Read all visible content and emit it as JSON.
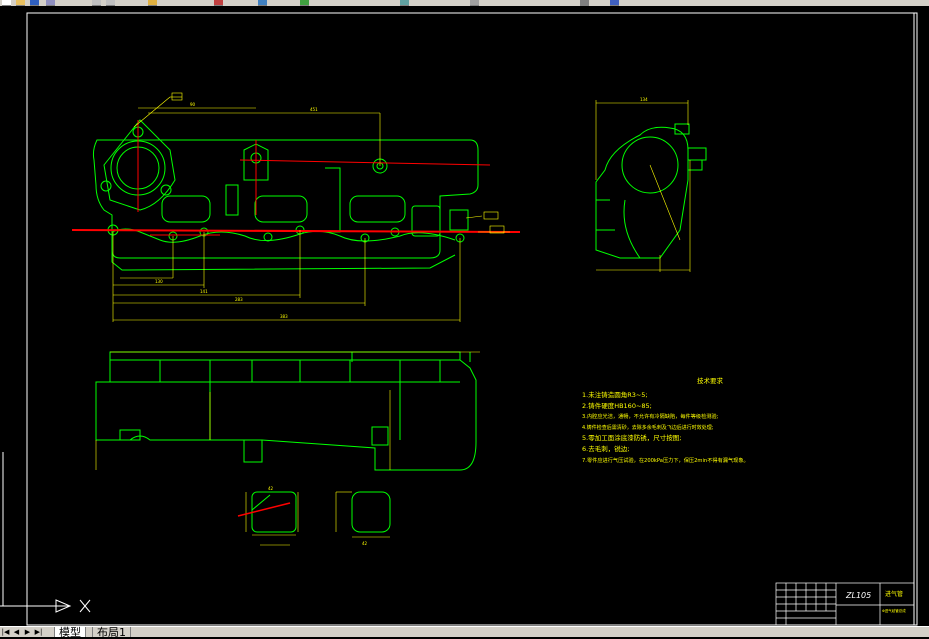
{
  "drawing": {
    "tech_title": "技术要求",
    "tech_notes": [
      "1.未注铸造圆角R3~5;",
      "2.铸件硬度HB160~85;",
      "3.内腔应光洁，通畅，不允许有冷隔缺陷，每件等级检测验;",
      "4.铸件检查后需清砂，去除多余毛刺及飞边后进行时效处理;",
      "5.零加工面涂底漆防锈，尺寸按图;",
      "6.去毛刺，锐边;",
      "7.零件应进行气压试验，在200kPa压力下，保压2min不得有漏气现象。"
    ],
    "title_block": {
      "part_code": "ZL105",
      "part_name": "进气管",
      "subtitle": "Φ进气歧管总成"
    },
    "dims": {
      "d1": "90",
      "d2": "451",
      "d3": "130",
      "d4": "141",
      "d5": "283",
      "d6": "383",
      "d7": "134",
      "d8": "42",
      "d9": "42"
    }
  },
  "ucs": {
    "x_label": "X"
  },
  "tabs": {
    "model": "模型",
    "layout1": "布局1"
  },
  "colors": {
    "outline": "#00ff00",
    "dimension": "#ffff00",
    "centerline": "#ff0000",
    "text": "#00ffff",
    "border": "#ffffff"
  }
}
